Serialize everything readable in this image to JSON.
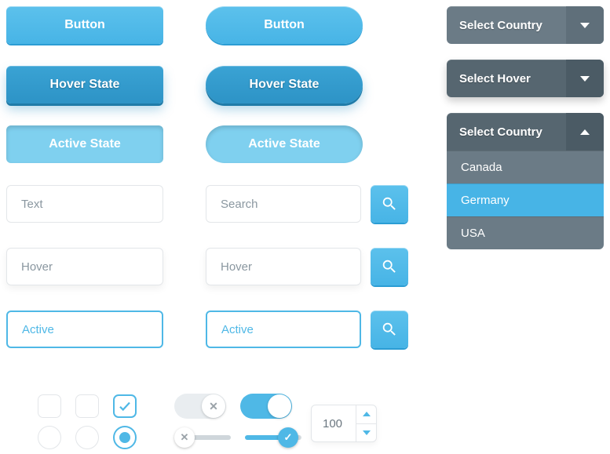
{
  "buttons": {
    "normal": "Button",
    "hover": "Hover State",
    "active": "Active State"
  },
  "inputs": {
    "text": "Text",
    "hover": "Hover",
    "active": "Active"
  },
  "search": {
    "placeholder": "Search",
    "hover": "Hover",
    "active": "Active"
  },
  "selects": {
    "normal": "Select Country",
    "hover": "Select Hover",
    "open_label": "Select Country",
    "options": [
      "Canada",
      "Germany",
      "USA"
    ],
    "highlighted_index": 1
  },
  "stepper": {
    "value": "100"
  },
  "colors": {
    "accent": "#4fb8e6",
    "dark": "#6b7b86"
  }
}
